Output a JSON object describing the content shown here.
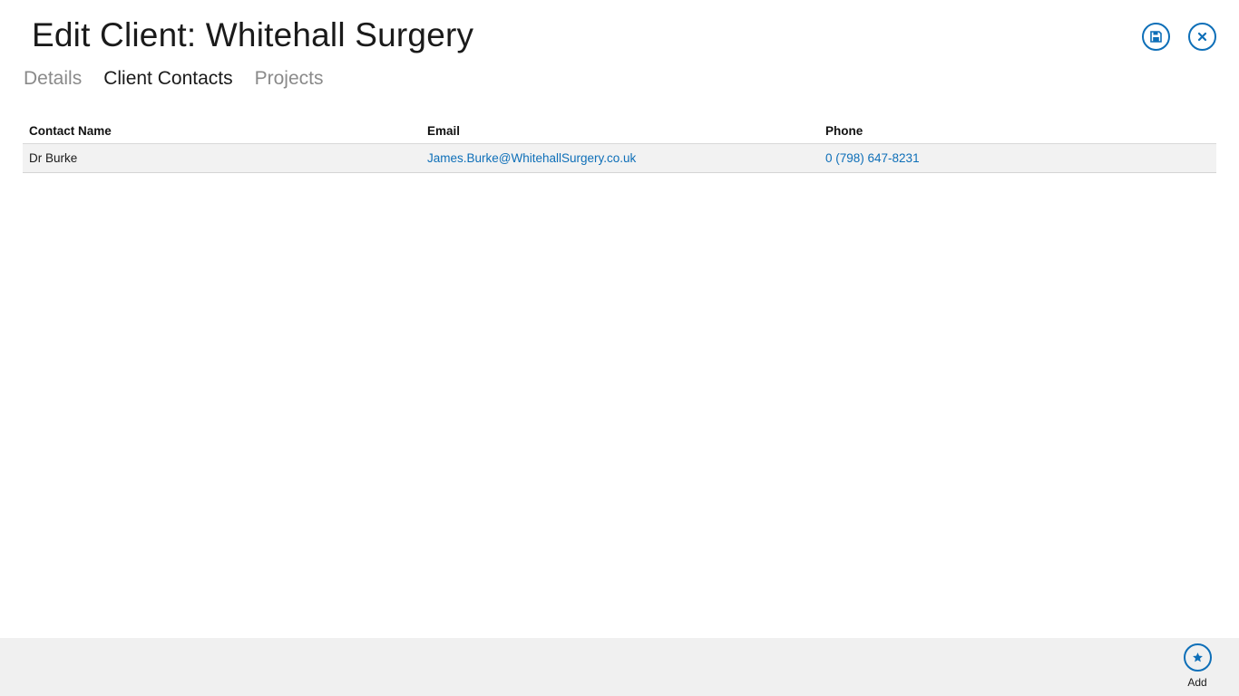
{
  "header": {
    "title": "Edit Client: Whitehall Surgery",
    "save_icon": "save-icon",
    "close_icon": "close-icon"
  },
  "tabs": [
    {
      "label": "Details",
      "active": false
    },
    {
      "label": "Client Contacts",
      "active": true
    },
    {
      "label": "Projects",
      "active": false
    }
  ],
  "contacts_table": {
    "columns": [
      "Contact Name",
      "Email",
      "Phone"
    ],
    "rows": [
      {
        "name": "Dr Burke",
        "email": "James.Burke@WhitehallSurgery.co.uk",
        "phone": "0 (798) 647-8231"
      }
    ]
  },
  "app_bar": {
    "add_label": "Add",
    "add_icon": "star-icon"
  },
  "colors": {
    "accent": "#0e6fb8",
    "row_background": "#f2f2f2",
    "app_bar_background": "#f0f0f0",
    "inactive_tab": "#8a8a8a"
  }
}
